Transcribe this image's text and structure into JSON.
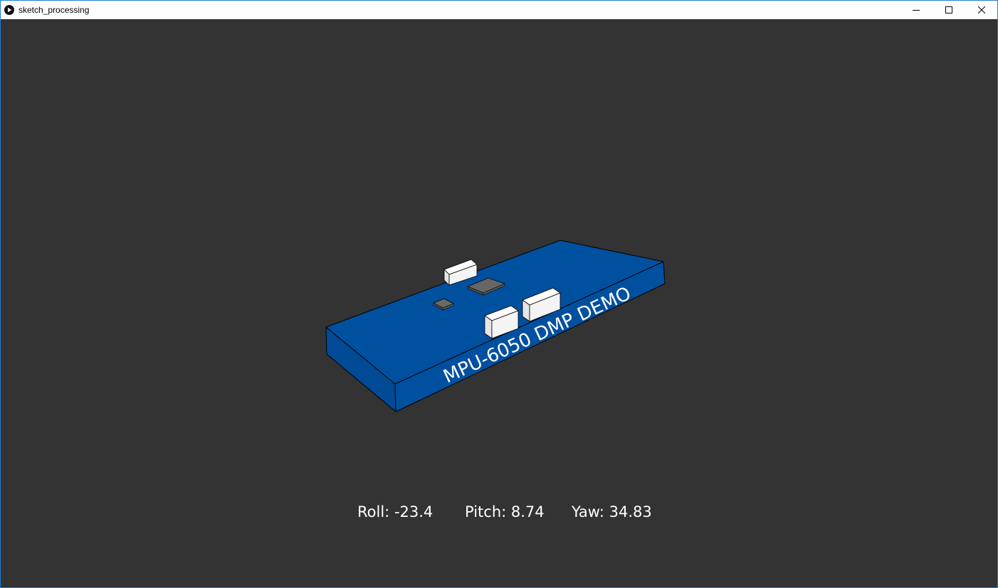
{
  "window": {
    "title": "sketch_processing",
    "frame_color": "#1e7fd6"
  },
  "titlebar": {
    "app_icon": "processing-play-icon",
    "controls": [
      "minimize-icon",
      "maximize-icon",
      "close-icon"
    ]
  },
  "canvas": {
    "background": "#333333"
  },
  "board": {
    "label": "MPU-6050 DMP DEMO",
    "color": "#0050a0",
    "components_color": "#ffffff",
    "chip_color": "#646464"
  },
  "readout": {
    "roll_label": "Roll:",
    "roll_value": "-23.4",
    "pitch_label": "Pitch:",
    "pitch_value": "8.74",
    "yaw_label": "Yaw:",
    "yaw_value": "34.83"
  }
}
